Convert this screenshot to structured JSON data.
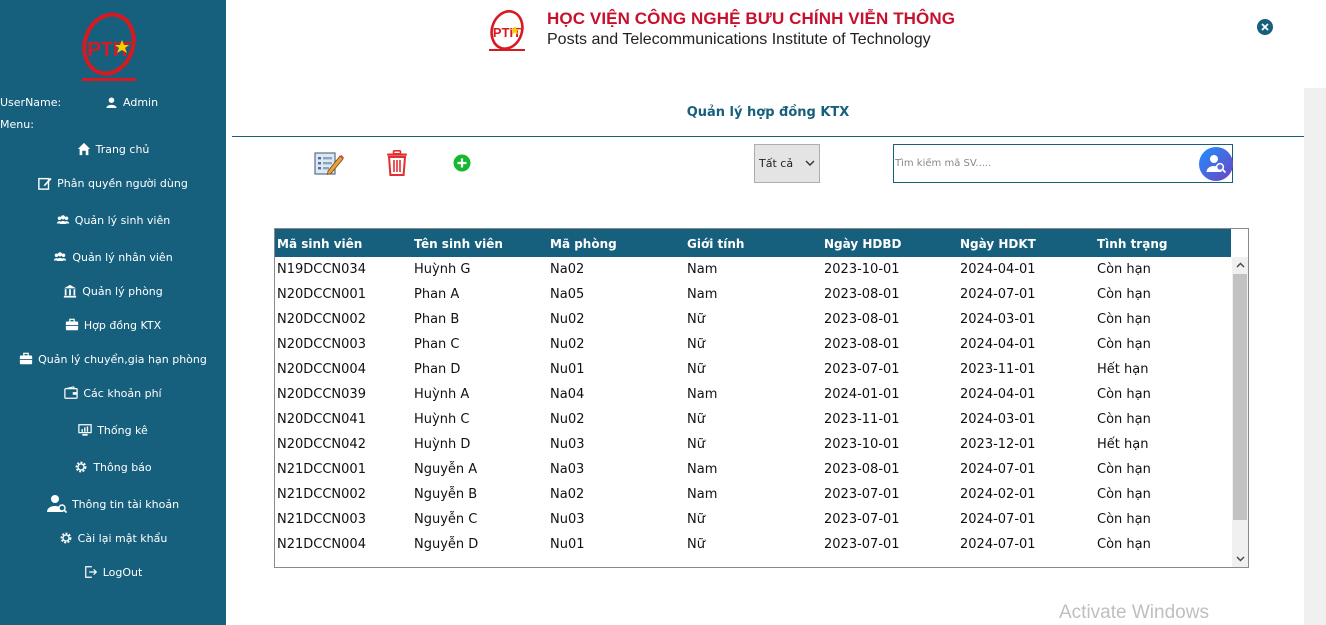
{
  "sidebar": {
    "logo_text": "PTIT",
    "username_label": "UserName:",
    "username_value": "Admin",
    "menu_label": "Menu:",
    "items": [
      {
        "label": "Trang chủ",
        "icon": "home-icon"
      },
      {
        "label": "Phân quyền người dùng",
        "icon": "edit-icon"
      },
      {
        "label": "Quản lý sinh viên",
        "icon": "users-icon"
      },
      {
        "label": "Quản lý nhân viên",
        "icon": "users-icon"
      },
      {
        "label": "Quản lý phòng",
        "icon": "building-icon"
      },
      {
        "label": "Hợp đồng KTX",
        "icon": "briefcase-icon"
      },
      {
        "label": "Quản lý chuyển,gia hạn phòng",
        "icon": "briefcase-icon"
      },
      {
        "label": "Các khoản phí",
        "icon": "wallet-icon"
      },
      {
        "label": "Thống kê",
        "icon": "monitor-icon"
      },
      {
        "label": "Thông báo",
        "icon": "gear-icon"
      },
      {
        "label": "Thông tin tài khoản",
        "icon": "user-search-icon"
      },
      {
        "label": "Cài lại mật khẩu",
        "icon": "gear-icon"
      },
      {
        "label": "LogOut",
        "icon": "logout-icon"
      }
    ]
  },
  "header": {
    "logo_text": "PTIT",
    "title_vn": "HỌC VIỆN CÔNG NGHỆ BƯU CHÍNH VIỄN THÔNG",
    "title_en": "Posts and Telecommunications Institute of Technology"
  },
  "page": {
    "title": "Quản lý hợp đồng KTX"
  },
  "toolbar": {
    "filter_selected": "Tất cả",
    "search_placeholder": "Tìm kiếm mã SV....."
  },
  "table": {
    "columns": [
      "Mã sinh viên",
      "Tên sinh viên",
      "Mã phòng",
      "Giới tính",
      "Ngày HDBD",
      "Ngày HDKT",
      "Tình trạng"
    ],
    "rows": [
      [
        "N19DCCN034",
        "Huỳnh G",
        "Na02",
        "Nam",
        "2023-10-01",
        "2024-04-01",
        "Còn hạn"
      ],
      [
        "N20DCCN001",
        "Phan A",
        "Na05",
        "Nam",
        "2023-08-01",
        "2024-07-01",
        "Còn hạn"
      ],
      [
        "N20DCCN002",
        "Phan B",
        "Nu02",
        "Nữ",
        "2023-08-01",
        "2024-03-01",
        "Còn hạn"
      ],
      [
        "N20DCCN003",
        "Phan C",
        "Nu02",
        "Nữ",
        "2023-08-01",
        "2024-04-01",
        "Còn hạn"
      ],
      [
        "N20DCCN004",
        "Phan D",
        "Nu01",
        "Nữ",
        "2023-07-01",
        "2023-11-01",
        "Hết hạn"
      ],
      [
        "N20DCCN039",
        "Huỳnh A",
        "Na04",
        "Nam",
        "2024-01-01",
        "2024-04-01",
        "Còn hạn"
      ],
      [
        "N20DCCN041",
        "Huỳnh C",
        "Nu02",
        "Nữ",
        "2023-11-01",
        "2024-03-01",
        "Còn hạn"
      ],
      [
        "N20DCCN042",
        "Huỳnh D",
        "Nu03",
        "Nữ",
        "2023-10-01",
        "2023-12-01",
        "Hết hạn"
      ],
      [
        "N21DCCN001",
        "Nguyễn A",
        "Na03",
        "Nam",
        "2023-08-01",
        "2024-07-01",
        "Còn hạn"
      ],
      [
        "N21DCCN002",
        "Nguyễn B",
        "Na02",
        "Nam",
        "2023-07-01",
        "2024-02-01",
        "Còn hạn"
      ],
      [
        "N21DCCN003",
        "Nguyễn C",
        "Nu03",
        "Nữ",
        "2023-07-01",
        "2024-07-01",
        "Còn hạn"
      ],
      [
        "N21DCCN004",
        "Nguyễn D",
        "Nu01",
        "Nữ",
        "2023-07-01",
        "2024-07-01",
        "Còn hạn"
      ]
    ]
  },
  "watermark": "Activate Windows",
  "colors": {
    "primary": "#17607d",
    "brand_red": "#c8102e",
    "add_green": "#16b830",
    "delete_red": "#e03030"
  }
}
